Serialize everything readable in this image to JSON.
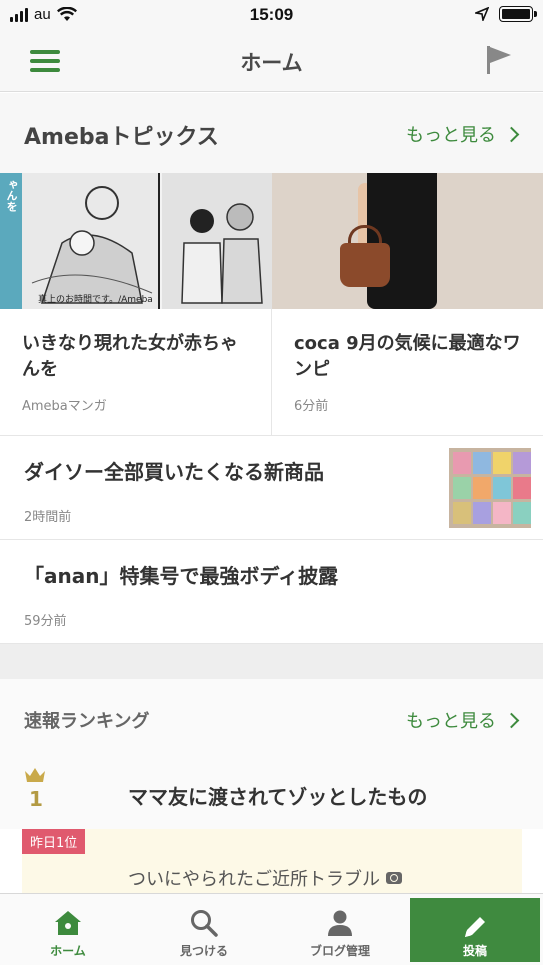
{
  "status_bar": {
    "carrier": "au",
    "time": "15:09"
  },
  "header": {
    "title": "ホーム",
    "menu_icon": "hamburger-menu-icon",
    "flag_icon": "flag-icon"
  },
  "topics": {
    "title": "Amebaトピックス",
    "more_label": "もっと見る",
    "manga_tag": "いきなり現れた女が赤ちゃんを",
    "manga_caption": "真上のお時間です。/Ameba",
    "cards": [
      {
        "title": "いきなり現れた女が赤ちゃんを",
        "meta": "Amebaマンガ"
      },
      {
        "title": "coca 9月の気候に最適なワンピ",
        "meta": "6分前"
      }
    ],
    "news": [
      {
        "title": "ダイソー全部買いたくなる新商品",
        "meta": "2時間前"
      },
      {
        "title": "「anan」特集号で最強ボディ披露",
        "meta": "59分前"
      }
    ]
  },
  "ranking": {
    "title": "速報ランキング",
    "more_label": "もっと見る",
    "top_item": {
      "rank": "1",
      "title": "ママ友に渡されてゾッとしたもの"
    },
    "yesterday_badge": "昨日1位",
    "yesterday_title": "ついにやられたご近所トラブル"
  },
  "tabbar": {
    "home": "ホーム",
    "discover": "見つける",
    "blog_manage": "ブログ管理",
    "post": "投稿"
  },
  "colors": {
    "accent": "#3d8a3d",
    "badge": "#e05a6e",
    "rank_gold": "#b39a43"
  }
}
